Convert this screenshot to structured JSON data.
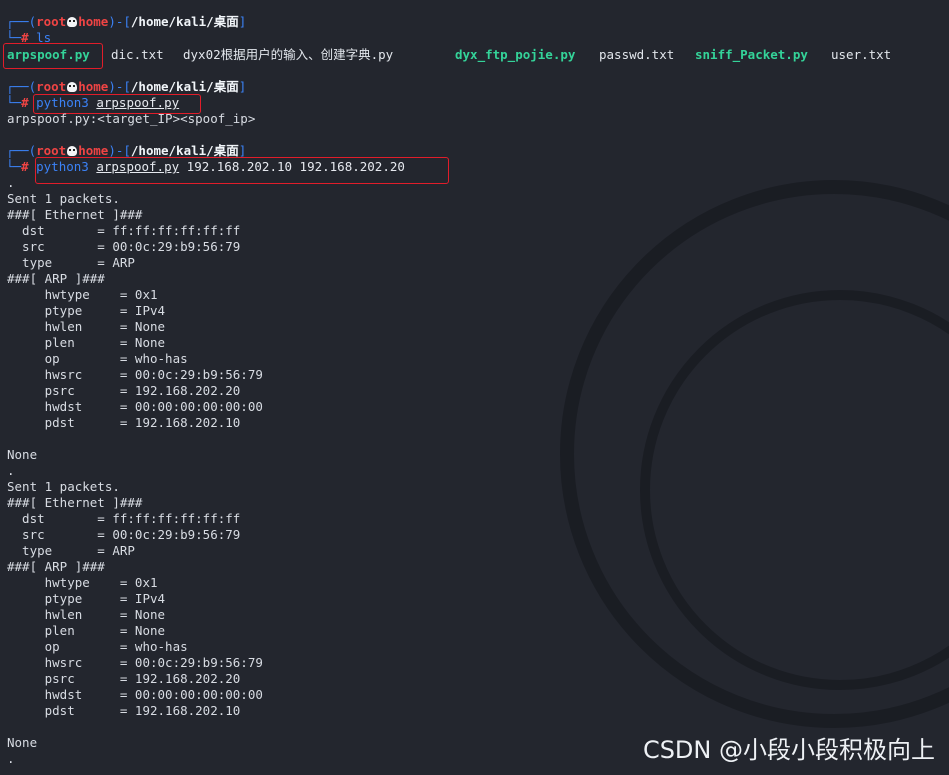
{
  "prompt": {
    "user": "root",
    "host": "home",
    "path": "/home/kali/桌面",
    "symbol": "#"
  },
  "commands": {
    "ls": "ls",
    "run1_cmd": "python3",
    "run1_arg": "arpspoof.py",
    "run2_cmd": "python3",
    "run2_arg": "arpspoof.py",
    "run2_ips": " 192.168.202.10 192.168.202.20"
  },
  "ls_output": [
    {
      "name": "arpspoof.py",
      "executable": true
    },
    {
      "name": "dic.txt",
      "executable": false
    },
    {
      "name": "dyx02根据用户的输入、创建字典.py",
      "executable": false
    },
    {
      "name": "dyx_ftp_pojie.py",
      "executable": true
    },
    {
      "name": "passwd.txt",
      "executable": false
    },
    {
      "name": "sniff_Packet.py",
      "executable": true
    },
    {
      "name": "user.txt",
      "executable": false
    }
  ],
  "usage_line": "arpspoof.py:<target_IP><spoof_ip>",
  "output_lines": [
    ".",
    "Sent 1 packets.",
    "###[ Ethernet ]###",
    "  dst       = ff:ff:ff:ff:ff:ff",
    "  src       = 00:0c:29:b9:56:79",
    "  type      = ARP",
    "###[ ARP ]###",
    "     hwtype    = 0x1",
    "     ptype     = IPv4",
    "     hwlen     = None",
    "     plen      = None",
    "     op        = who-has",
    "     hwsrc     = 00:0c:29:b9:56:79",
    "     psrc      = 192.168.202.20",
    "     hwdst     = 00:00:00:00:00:00",
    "     pdst      = 192.168.202.10",
    "",
    "None",
    ".",
    "Sent 1 packets.",
    "###[ Ethernet ]###",
    "  dst       = ff:ff:ff:ff:ff:ff",
    "  src       = 00:0c:29:b9:56:79",
    "  type      = ARP",
    "###[ ARP ]###",
    "     hwtype    = 0x1",
    "     ptype     = IPv4",
    "     hwlen     = None",
    "     plen      = None",
    "     op        = who-has",
    "     hwsrc     = 00:0c:29:b9:56:79",
    "     psrc      = 192.168.202.20",
    "     hwdst     = 00:00:00:00:00:00",
    "     pdst      = 192.168.202.10",
    "",
    "None",
    "."
  ],
  "watermark": "CSDN @小段小段积极向上",
  "colors": {
    "background": "#23262e",
    "prompt_blue": "#3b82f6",
    "prompt_red": "#ef4444",
    "exec_green": "#34d399",
    "highlight_box": "#e11d2a"
  }
}
